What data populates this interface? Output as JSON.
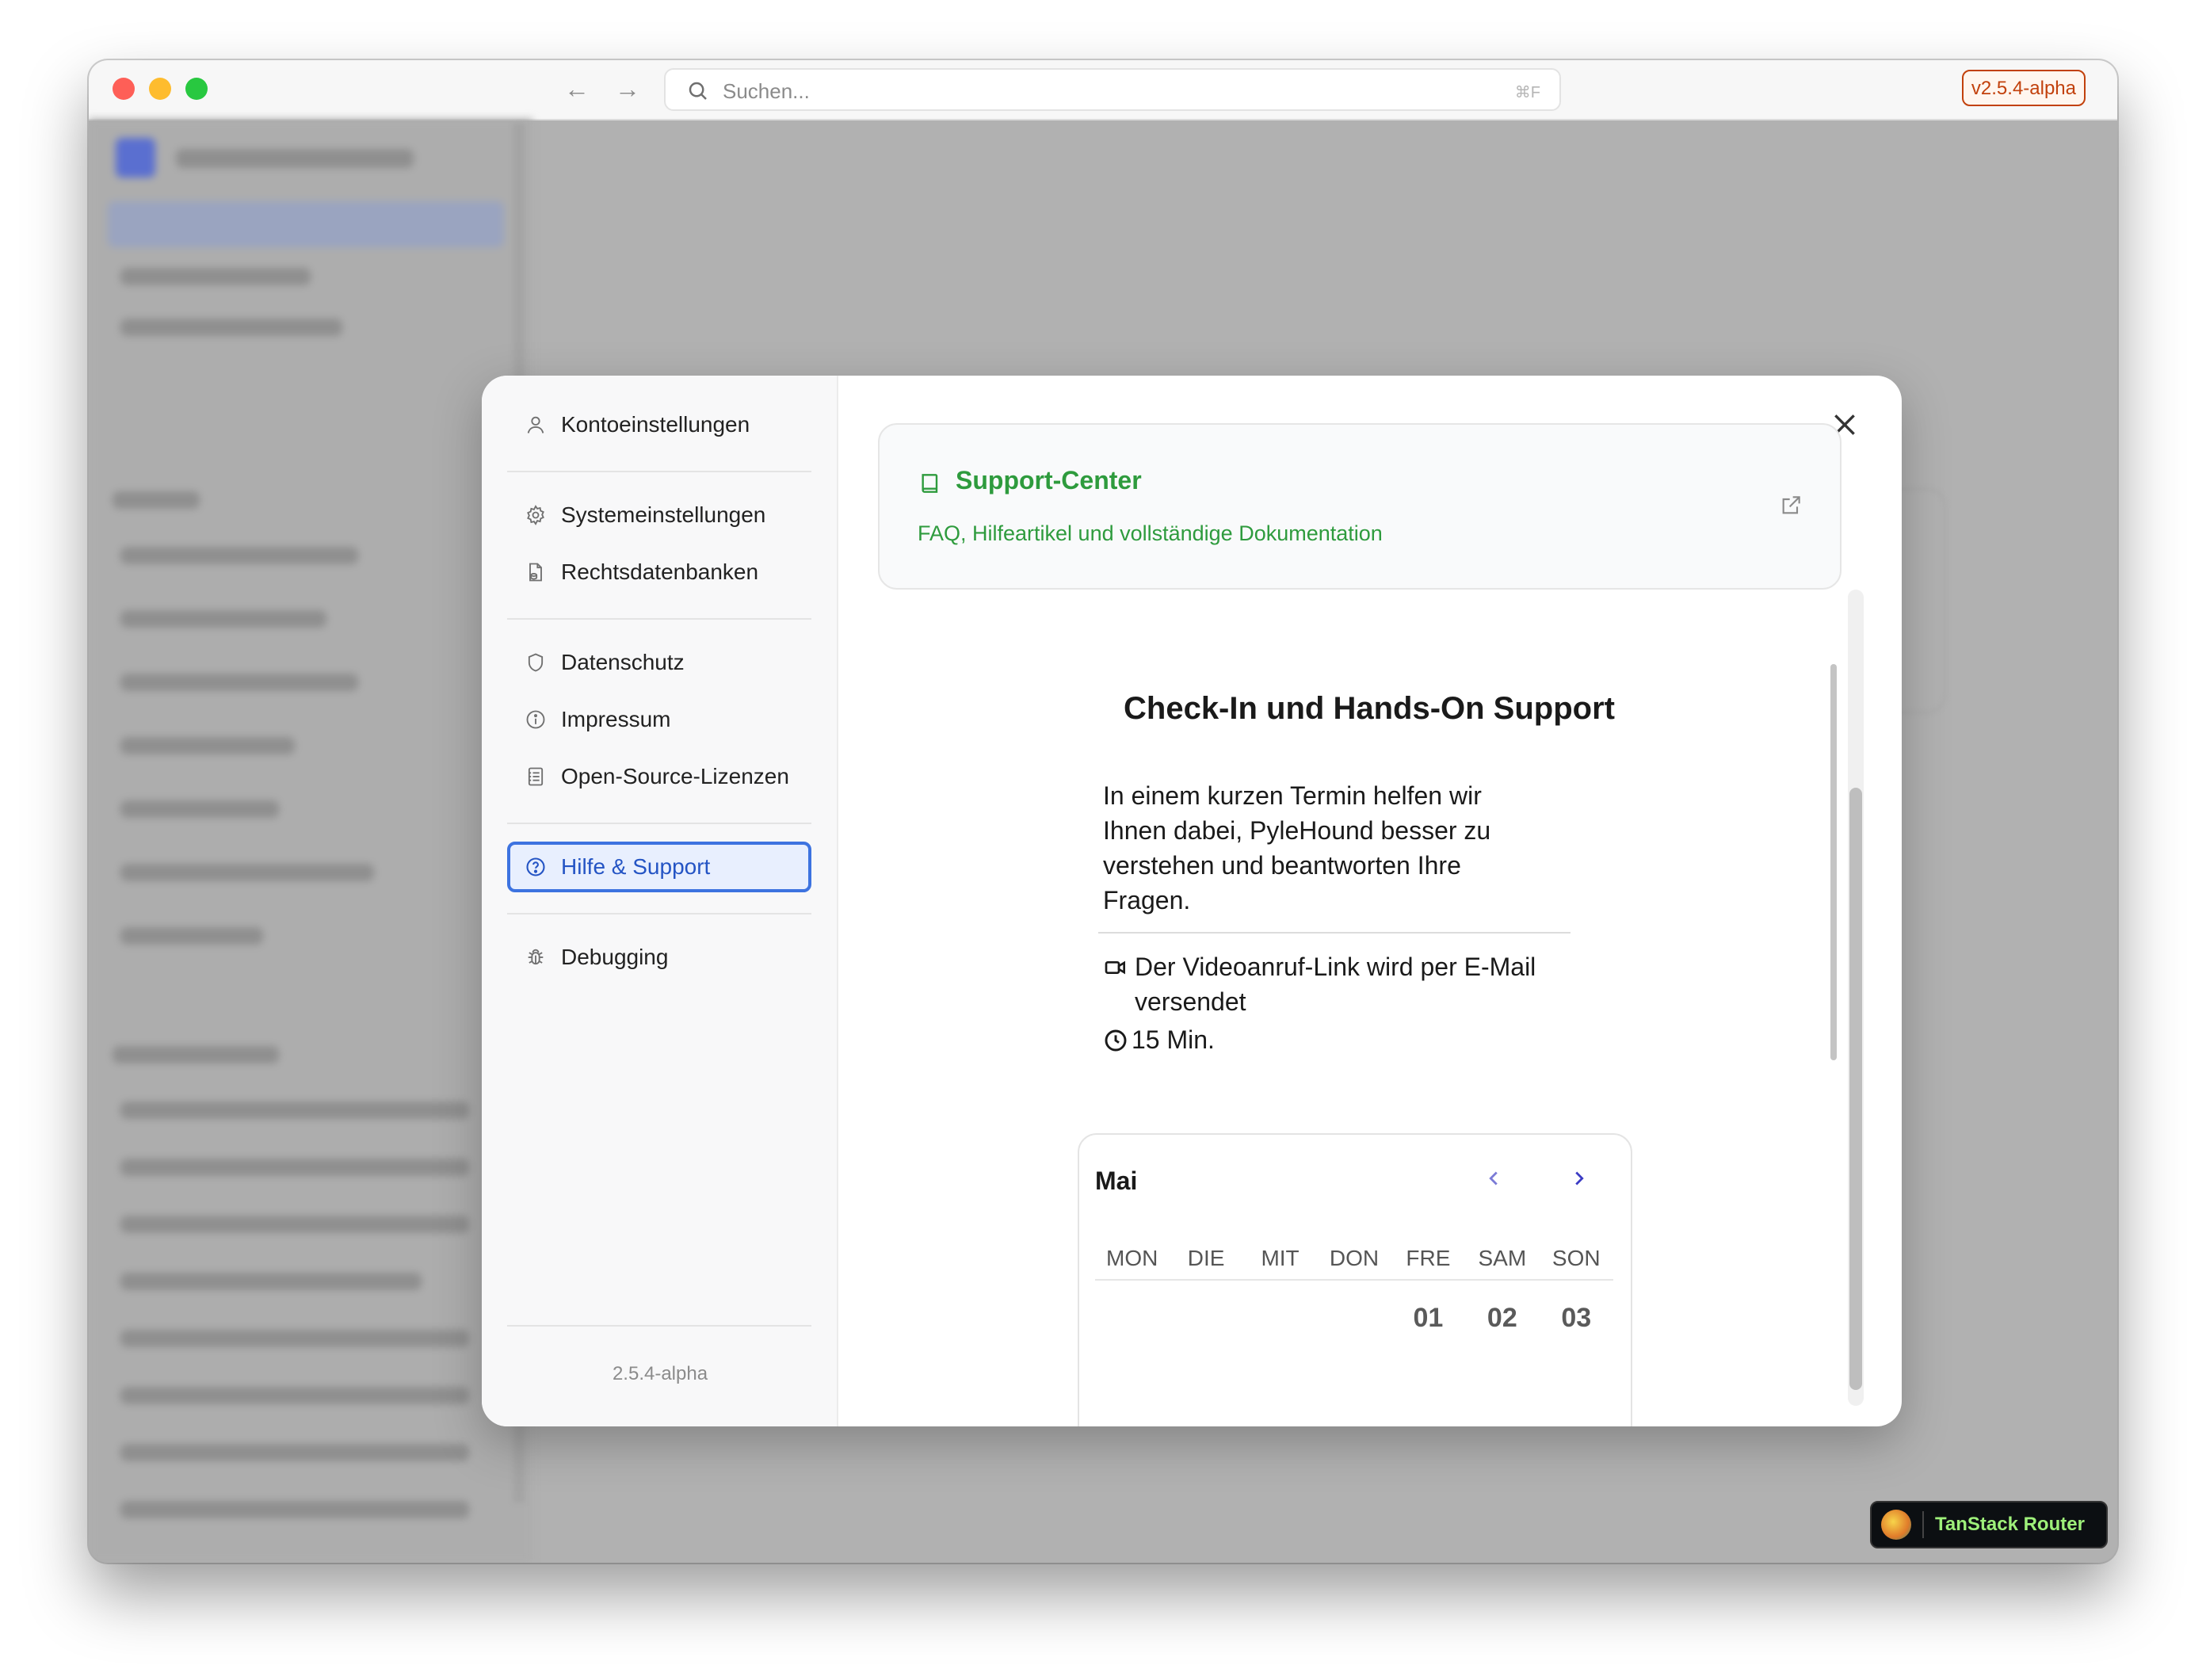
{
  "titlebar": {
    "search_placeholder": "Suchen...",
    "search_shortcut": "⌘F",
    "version_badge": "v2.5.4-alpha"
  },
  "settings_menu": {
    "items": [
      {
        "label": "Kontoeinstellungen",
        "icon": "user-icon"
      },
      {
        "label": "Systemeinstellungen",
        "icon": "gear-icon"
      },
      {
        "label": "Rechtsdatenbanken",
        "icon": "database-file-icon"
      },
      {
        "label": "Datenschutz",
        "icon": "shield-icon"
      },
      {
        "label": "Impressum",
        "icon": "info-icon"
      },
      {
        "label": "Open-Source-Lizenzen",
        "icon": "license-icon"
      },
      {
        "label": "Hilfe & Support",
        "icon": "help-icon",
        "active": true
      },
      {
        "label": "Debugging",
        "icon": "bug-icon"
      }
    ],
    "app_version": "2.5.4-alpha"
  },
  "support_card": {
    "title": "Support-Center",
    "subtitle": "FAQ, Hilfeartikel und vollständige Dokumentation",
    "color": "#2e9b3d"
  },
  "booking": {
    "title": "Check-In und Hands-On Support",
    "description": "In einem kurzen Termin helfen wir Ihnen dabei, PyleHound besser zu verstehen und beantworten Ihre Fragen.",
    "video_info": "Der Videoanruf-Link wird per E-Mail versendet",
    "duration": "15 Min."
  },
  "calendar": {
    "month": "Mai",
    "weekdays": [
      "MON",
      "DIE",
      "MIT",
      "DON",
      "FRE",
      "SAM",
      "SON"
    ],
    "first_row": [
      "",
      "",
      "",
      "",
      "01",
      "02",
      "03"
    ]
  },
  "devtools": {
    "label": "TanStack Router"
  },
  "colors": {
    "accent": "#3d73e0",
    "support_green": "#2e9b3d",
    "version_badge": "#c2410c"
  }
}
